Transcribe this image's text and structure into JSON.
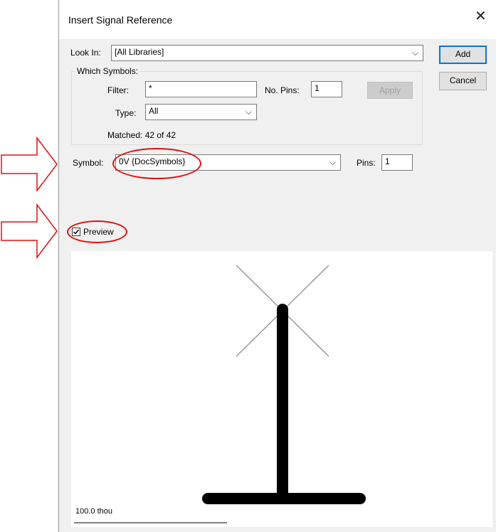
{
  "dialog": {
    "title": "Insert Signal Reference"
  },
  "look_in": {
    "label": "Look In:",
    "value": "[All Libraries]"
  },
  "which_symbols": {
    "title": "Which Symbols:",
    "filter_label": "Filter:",
    "filter_value": "*",
    "no_pins_label": "No. Pins:",
    "no_pins_value": "1",
    "apply_label": "Apply",
    "type_label": "Type:",
    "type_value": "All",
    "matched_text": "Matched: 42 of 42"
  },
  "symbol": {
    "label": "Symbol:",
    "value": "0V {DocSymbols}",
    "pins_label": "Pins:",
    "pins_value": "1"
  },
  "buttons": {
    "add_label": "Add",
    "cancel_label": "Cancel"
  },
  "preview": {
    "label": "Preview",
    "checked": true,
    "scale_text": "100.0 thou"
  },
  "annotations": {
    "highlight_color": "#e01010",
    "arrow_color": "#e01010"
  },
  "icons": {
    "close": "close-icon",
    "dropdown": "chevron-down-icon",
    "check": "checkmark-icon"
  }
}
